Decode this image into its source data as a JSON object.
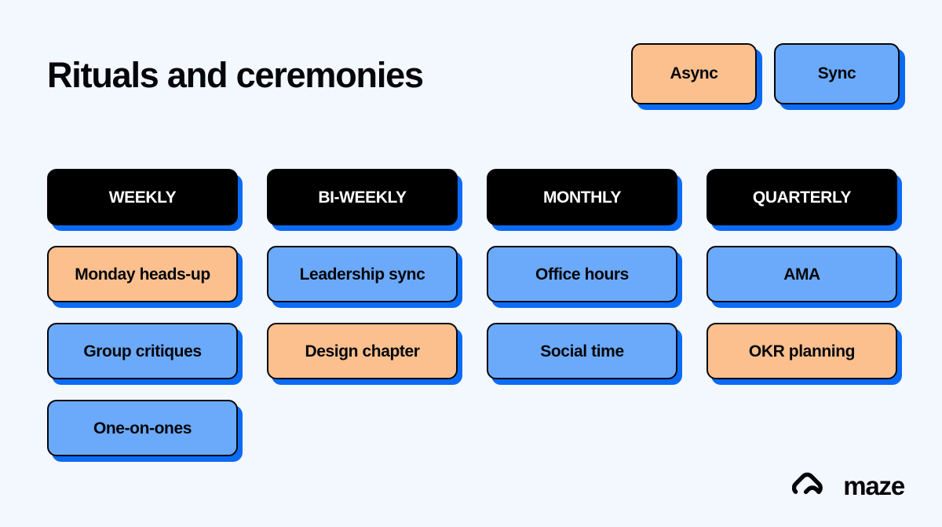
{
  "header": {
    "title": "Rituals and ceremonies",
    "legend": [
      {
        "label": "Async",
        "type": "async",
        "color": "#fbc08e"
      },
      {
        "label": "Sync",
        "type": "sync",
        "color": "#6baafa"
      }
    ]
  },
  "colors": {
    "background": "#f3f7fe",
    "shadow_blue": "#0b6bf5",
    "async_fill": "#fbc08e",
    "sync_fill": "#6baafa",
    "header_fill": "#000000",
    "text": "#05060a"
  },
  "columns": [
    {
      "header": "WEEKLY",
      "cards": [
        {
          "label": "Monday heads-up",
          "type": "async"
        },
        {
          "label": "Group critiques",
          "type": "sync"
        },
        {
          "label": "One-on-ones",
          "type": "sync"
        }
      ]
    },
    {
      "header": "BI-WEEKLY",
      "cards": [
        {
          "label": "Leadership sync",
          "type": "sync"
        },
        {
          "label": "Design chapter",
          "type": "async"
        }
      ]
    },
    {
      "header": "MONTHLY",
      "cards": [
        {
          "label": "Office hours",
          "type": "sync"
        },
        {
          "label": "Social time",
          "type": "sync"
        }
      ]
    },
    {
      "header": "QUARTERLY",
      "cards": [
        {
          "label": "AMA",
          "type": "sync"
        },
        {
          "label": "OKR planning",
          "type": "async"
        }
      ]
    }
  ],
  "brand": {
    "name": "maze",
    "mark": "maze-logo-icon"
  }
}
